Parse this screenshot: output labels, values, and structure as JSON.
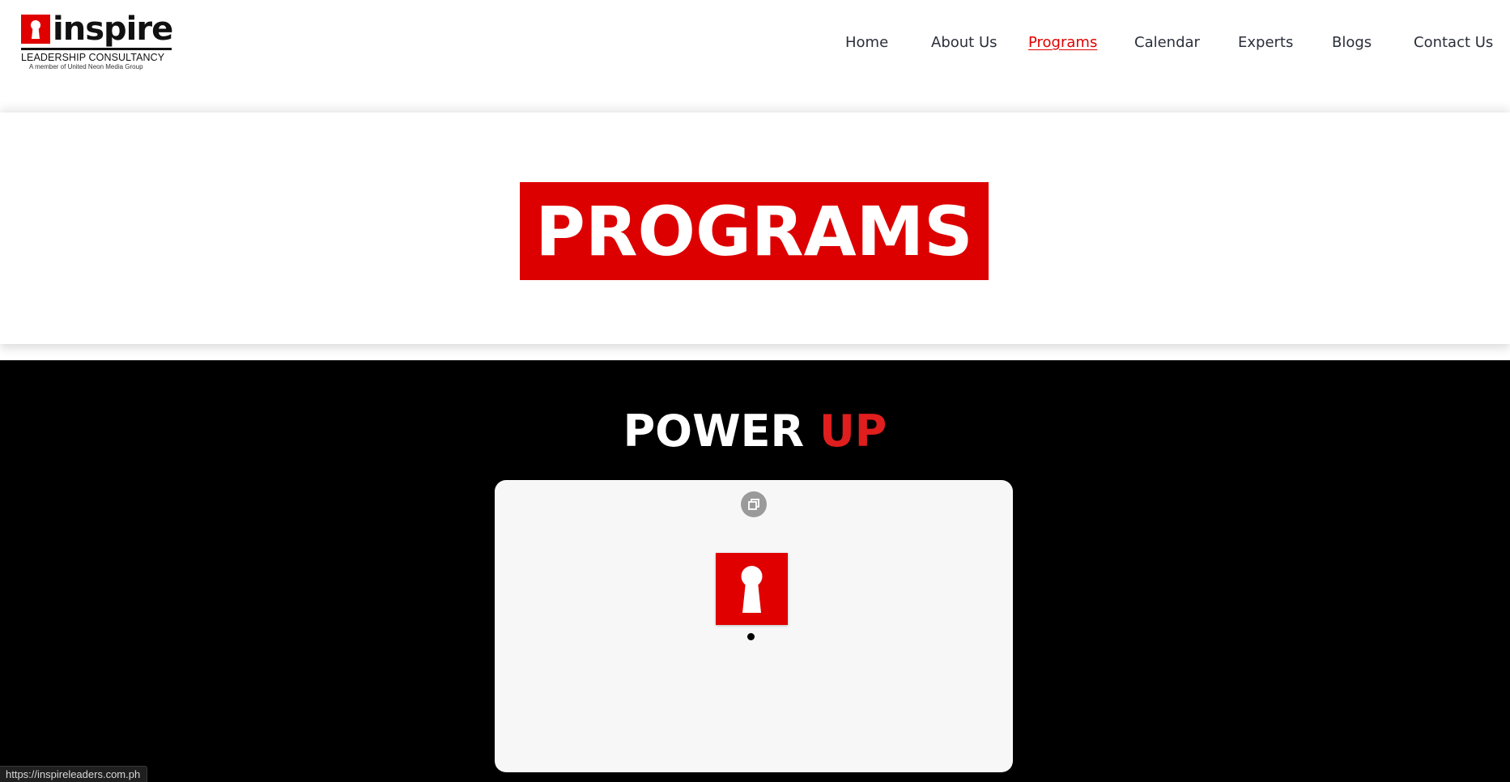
{
  "brand": {
    "wordmark": "inspire",
    "line1": "LEADERSHIP CONSULTANCY",
    "line2": "A member of United Neon Media Group",
    "accent_color": "#e00000"
  },
  "nav": {
    "items": [
      {
        "label": "Home",
        "active": false
      },
      {
        "label": "About Us",
        "active": false
      },
      {
        "label": "Programs",
        "active": true
      },
      {
        "label": "Calendar",
        "active": false
      },
      {
        "label": "Experts",
        "active": false
      },
      {
        "label": "Blogs",
        "active": false
      },
      {
        "label": "Contact Us",
        "active": false
      }
    ]
  },
  "hero": {
    "title": "PROGRAMS"
  },
  "section": {
    "heading_white": "POWER",
    "heading_accent": "UP",
    "accent_color": "#e01e1e"
  },
  "card": {
    "icon": "expand-gallery-icon",
    "image": "keyhole-logo-icon",
    "indicator": "carousel-dot-icon"
  },
  "status_bar": {
    "url": "https://inspireleaders.com.ph"
  }
}
